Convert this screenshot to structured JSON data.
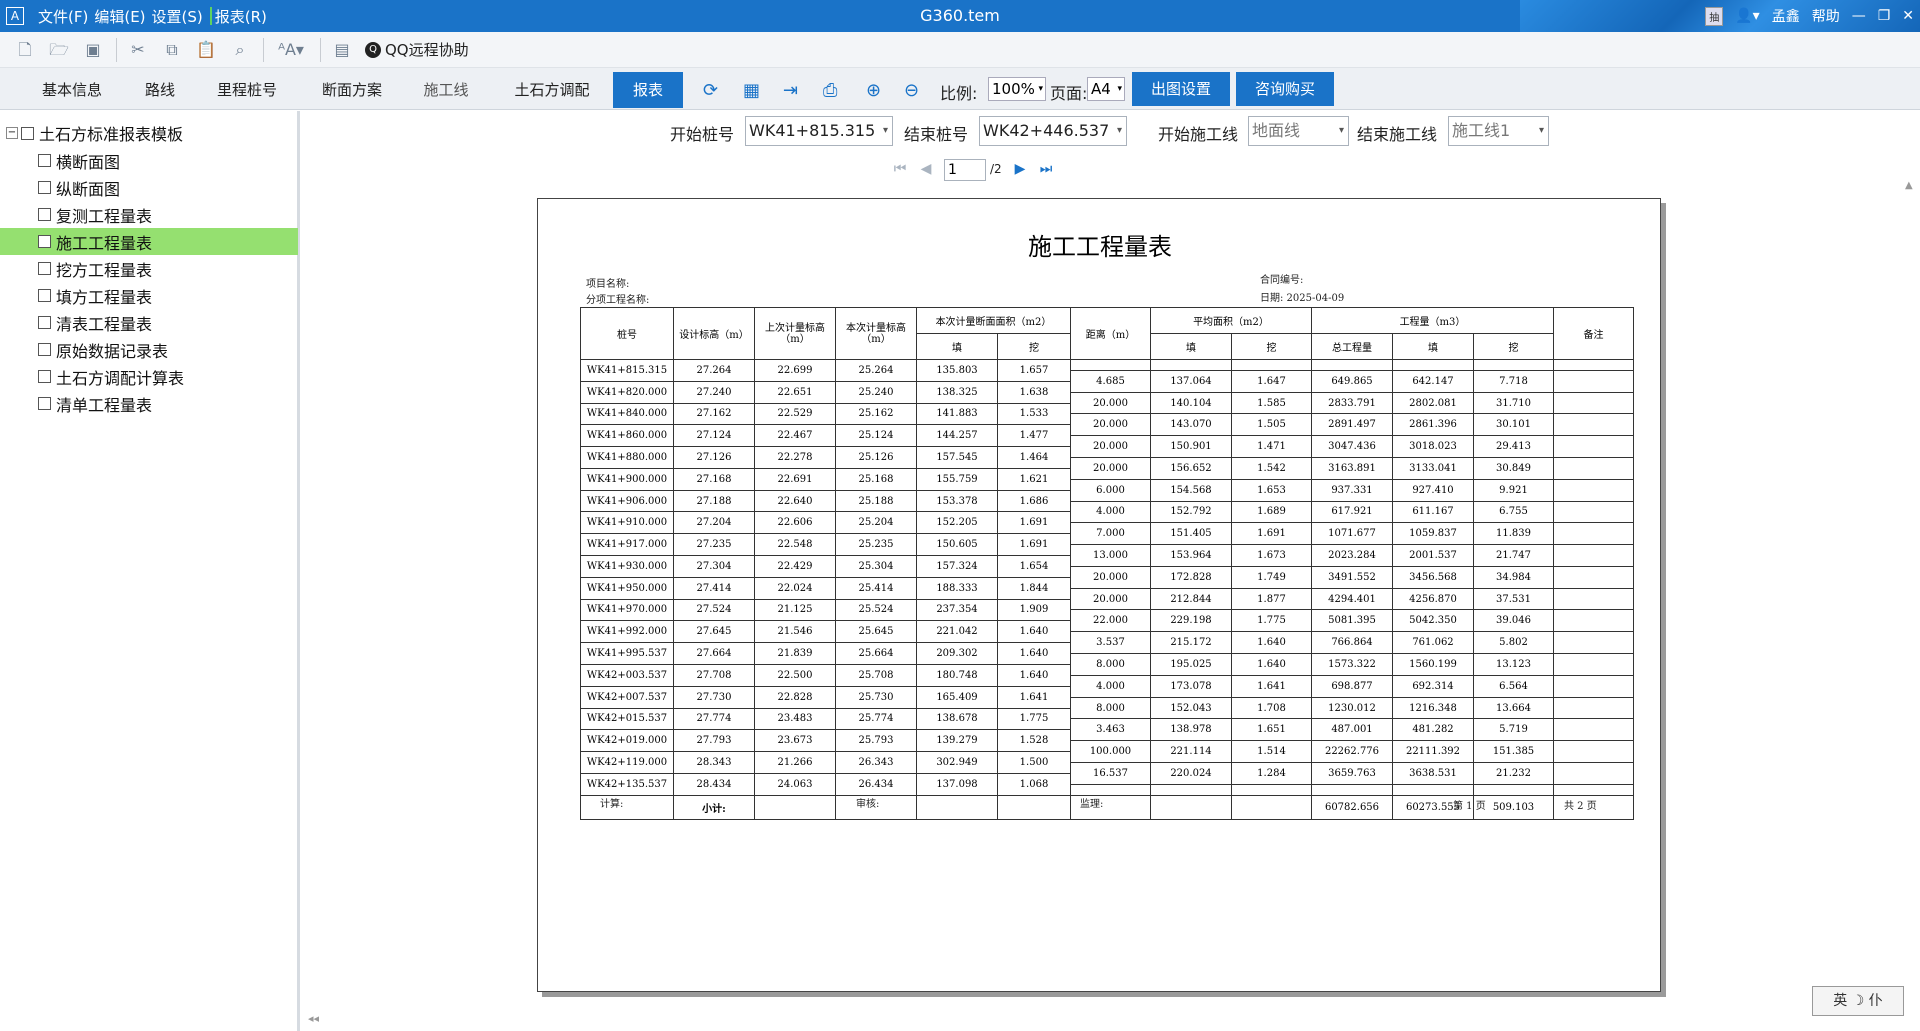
{
  "titlebar": {
    "menus": [
      "文件(F)",
      "编辑(E)",
      "设置(S)",
      "报表(R)"
    ],
    "title": "G360.tem",
    "ime_badge": "抽",
    "user": "孟鑫",
    "help": "帮助"
  },
  "toolbar": {
    "icons": [
      "new-file-icon",
      "open-folder-icon",
      "save-icon",
      "cut-icon",
      "copy-icon",
      "paste-icon",
      "search-icon",
      "font-icon",
      "calculator-icon"
    ],
    "qq_label": "QQ远程协助"
  },
  "tabs": [
    {
      "label": "基本信息",
      "state": "normal"
    },
    {
      "label": "路线",
      "state": "normal"
    },
    {
      "label": "里程桩号",
      "state": "normal"
    },
    {
      "label": "断面方案",
      "state": "normal"
    },
    {
      "label": "施工线",
      "state": "dim"
    },
    {
      "label": "土石方调配",
      "state": "normal"
    },
    {
      "label": "报表",
      "state": "active"
    }
  ],
  "report_tools": {
    "scale_label": "比例:",
    "scale_value": "100%",
    "page_label": "页面:",
    "page_value": "A4",
    "print_settings": "出图设置",
    "consult_buy": "咨询购买"
  },
  "sidebar": {
    "root": "土石方标准报表模板",
    "items": [
      "横断面图",
      "纵断面图",
      "复测工程量表",
      "施工工程量表",
      "挖方工程量表",
      "填方工程量表",
      "清表工程量表",
      "原始数据记录表",
      "土石方调配计算表",
      "清单工程量表"
    ],
    "selected": 3
  },
  "filters": {
    "start_station_label": "开始桩号",
    "start_station": "WK41+815.315",
    "end_station_label": "结束桩号",
    "end_station": "WK42+446.537",
    "start_line_label": "开始施工线",
    "start_line": "地面线",
    "end_line_label": "结束施工线",
    "end_line": "施工线1"
  },
  "pager": {
    "current": "1",
    "total": "/2"
  },
  "report": {
    "title": "施工工程量表",
    "project_name": "项目名称:",
    "sub_project": "分项工程名称:",
    "contract_no": "合同编号:",
    "date": "日期: 2025-04-09",
    "headers": {
      "station": "桩号",
      "design_elev": "设计标高（m）",
      "last_elev": "上次计量标高（m）",
      "this_elev": "本次计量标高（m）",
      "area_group": "本次计量断面面积（m2）",
      "fill": "填",
      "cut": "挖",
      "distance": "距离（m）",
      "avg_group": "平均面积（m2）",
      "qty_group": "工程量（m3）",
      "total_qty": "总工程量",
      "remark": "备注"
    },
    "rows": [
      [
        "WK41+815.315",
        "27.264",
        "22.699",
        "25.264",
        "135.803",
        "1.657"
      ],
      [
        "WK41+820.000",
        "27.240",
        "22.651",
        "25.240",
        "138.325",
        "1.638"
      ],
      [
        "WK41+840.000",
        "27.162",
        "22.529",
        "25.162",
        "141.883",
        "1.533"
      ],
      [
        "WK41+860.000",
        "27.124",
        "22.467",
        "25.124",
        "144.257",
        "1.477"
      ],
      [
        "WK41+880.000",
        "27.126",
        "22.278",
        "25.126",
        "157.545",
        "1.464"
      ],
      [
        "WK41+900.000",
        "27.168",
        "22.691",
        "25.168",
        "155.759",
        "1.621"
      ],
      [
        "WK41+906.000",
        "27.188",
        "22.640",
        "25.188",
        "153.378",
        "1.686"
      ],
      [
        "WK41+910.000",
        "27.204",
        "22.606",
        "25.204",
        "152.205",
        "1.691"
      ],
      [
        "WK41+917.000",
        "27.235",
        "22.548",
        "25.235",
        "150.605",
        "1.691"
      ],
      [
        "WK41+930.000",
        "27.304",
        "22.429",
        "25.304",
        "157.324",
        "1.654"
      ],
      [
        "WK41+950.000",
        "27.414",
        "22.024",
        "25.414",
        "188.333",
        "1.844"
      ],
      [
        "WK41+970.000",
        "27.524",
        "21.125",
        "25.524",
        "237.354",
        "1.909"
      ],
      [
        "WK41+992.000",
        "27.645",
        "21.546",
        "25.645",
        "221.042",
        "1.640"
      ],
      [
        "WK41+995.537",
        "27.664",
        "21.839",
        "25.664",
        "209.302",
        "1.640"
      ],
      [
        "WK42+003.537",
        "27.708",
        "22.500",
        "25.708",
        "180.748",
        "1.640"
      ],
      [
        "WK42+007.537",
        "27.730",
        "22.828",
        "25.730",
        "165.409",
        "1.641"
      ],
      [
        "WK42+015.537",
        "27.774",
        "23.483",
        "25.774",
        "138.678",
        "1.775"
      ],
      [
        "WK42+019.000",
        "27.793",
        "23.673",
        "25.793",
        "139.279",
        "1.528"
      ],
      [
        "WK42+119.000",
        "28.343",
        "21.266",
        "26.343",
        "302.949",
        "1.500"
      ],
      [
        "WK42+135.537",
        "28.434",
        "24.063",
        "26.434",
        "137.098",
        "1.068"
      ]
    ],
    "intervals": [
      [
        "4.685",
        "137.064",
        "1.647",
        "649.865",
        "642.147",
        "7.718"
      ],
      [
        "20.000",
        "140.104",
        "1.585",
        "2833.791",
        "2802.081",
        "31.710"
      ],
      [
        "20.000",
        "143.070",
        "1.505",
        "2891.497",
        "2861.396",
        "30.101"
      ],
      [
        "20.000",
        "150.901",
        "1.471",
        "3047.436",
        "3018.023",
        "29.413"
      ],
      [
        "20.000",
        "156.652",
        "1.542",
        "3163.891",
        "3133.041",
        "30.849"
      ],
      [
        "6.000",
        "154.568",
        "1.653",
        "937.331",
        "927.410",
        "9.921"
      ],
      [
        "4.000",
        "152.792",
        "1.689",
        "617.921",
        "611.167",
        "6.755"
      ],
      [
        "7.000",
        "151.405",
        "1.691",
        "1071.677",
        "1059.837",
        "11.839"
      ],
      [
        "13.000",
        "153.964",
        "1.673",
        "2023.284",
        "2001.537",
        "21.747"
      ],
      [
        "20.000",
        "172.828",
        "1.749",
        "3491.552",
        "3456.568",
        "34.984"
      ],
      [
        "20.000",
        "212.844",
        "1.877",
        "4294.401",
        "4256.870",
        "37.531"
      ],
      [
        "22.000",
        "229.198",
        "1.775",
        "5081.395",
        "5042.350",
        "39.046"
      ],
      [
        "3.537",
        "215.172",
        "1.640",
        "766.864",
        "761.062",
        "5.802"
      ],
      [
        "8.000",
        "195.025",
        "1.640",
        "1573.322",
        "1560.199",
        "13.123"
      ],
      [
        "4.000",
        "173.078",
        "1.641",
        "698.877",
        "692.314",
        "6.564"
      ],
      [
        "8.000",
        "152.043",
        "1.708",
        "1230.012",
        "1216.348",
        "13.664"
      ],
      [
        "3.463",
        "138.978",
        "1.651",
        "487.001",
        "481.282",
        "5.719"
      ],
      [
        "100.000",
        "221.114",
        "1.514",
        "22262.776",
        "22111.392",
        "151.385"
      ],
      [
        "16.537",
        "220.024",
        "1.284",
        "3659.763",
        "3638.531",
        "21.232"
      ]
    ],
    "subtotal_label": "小计:",
    "subtotal": [
      "60782.656",
      "60273.555",
      "509.103"
    ],
    "footer": {
      "calc": "计算:",
      "review": "审核:",
      "supervise": "监理:",
      "page": "第 1 页",
      "total_pages": "共 2 页"
    }
  },
  "ime": "英 ☽ 仆"
}
